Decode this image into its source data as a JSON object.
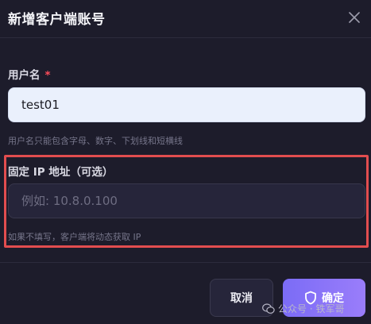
{
  "dialog": {
    "title": "新增客户端账号",
    "close_icon": "close-icon"
  },
  "username": {
    "label": "用户名",
    "required_mark": "*",
    "value": "test01",
    "hint": "用户名只能包含字母、数字、下划线和短横线"
  },
  "fixed_ip": {
    "label": "固定 IP 地址（可选）",
    "placeholder": "例如: 10.8.0.100",
    "value": "",
    "hint": "如果不填写，客户端将动态获取 IP"
  },
  "footer": {
    "cancel_label": "取消",
    "confirm_label": "确定",
    "confirm_icon": "shield-icon"
  },
  "watermark": {
    "text": "公众号 · 铁军哥"
  },
  "colors": {
    "background": "#1d1c2b",
    "accent": "#8b74f8",
    "required": "#ff4d5b",
    "highlight_box": "#e24d4f"
  }
}
